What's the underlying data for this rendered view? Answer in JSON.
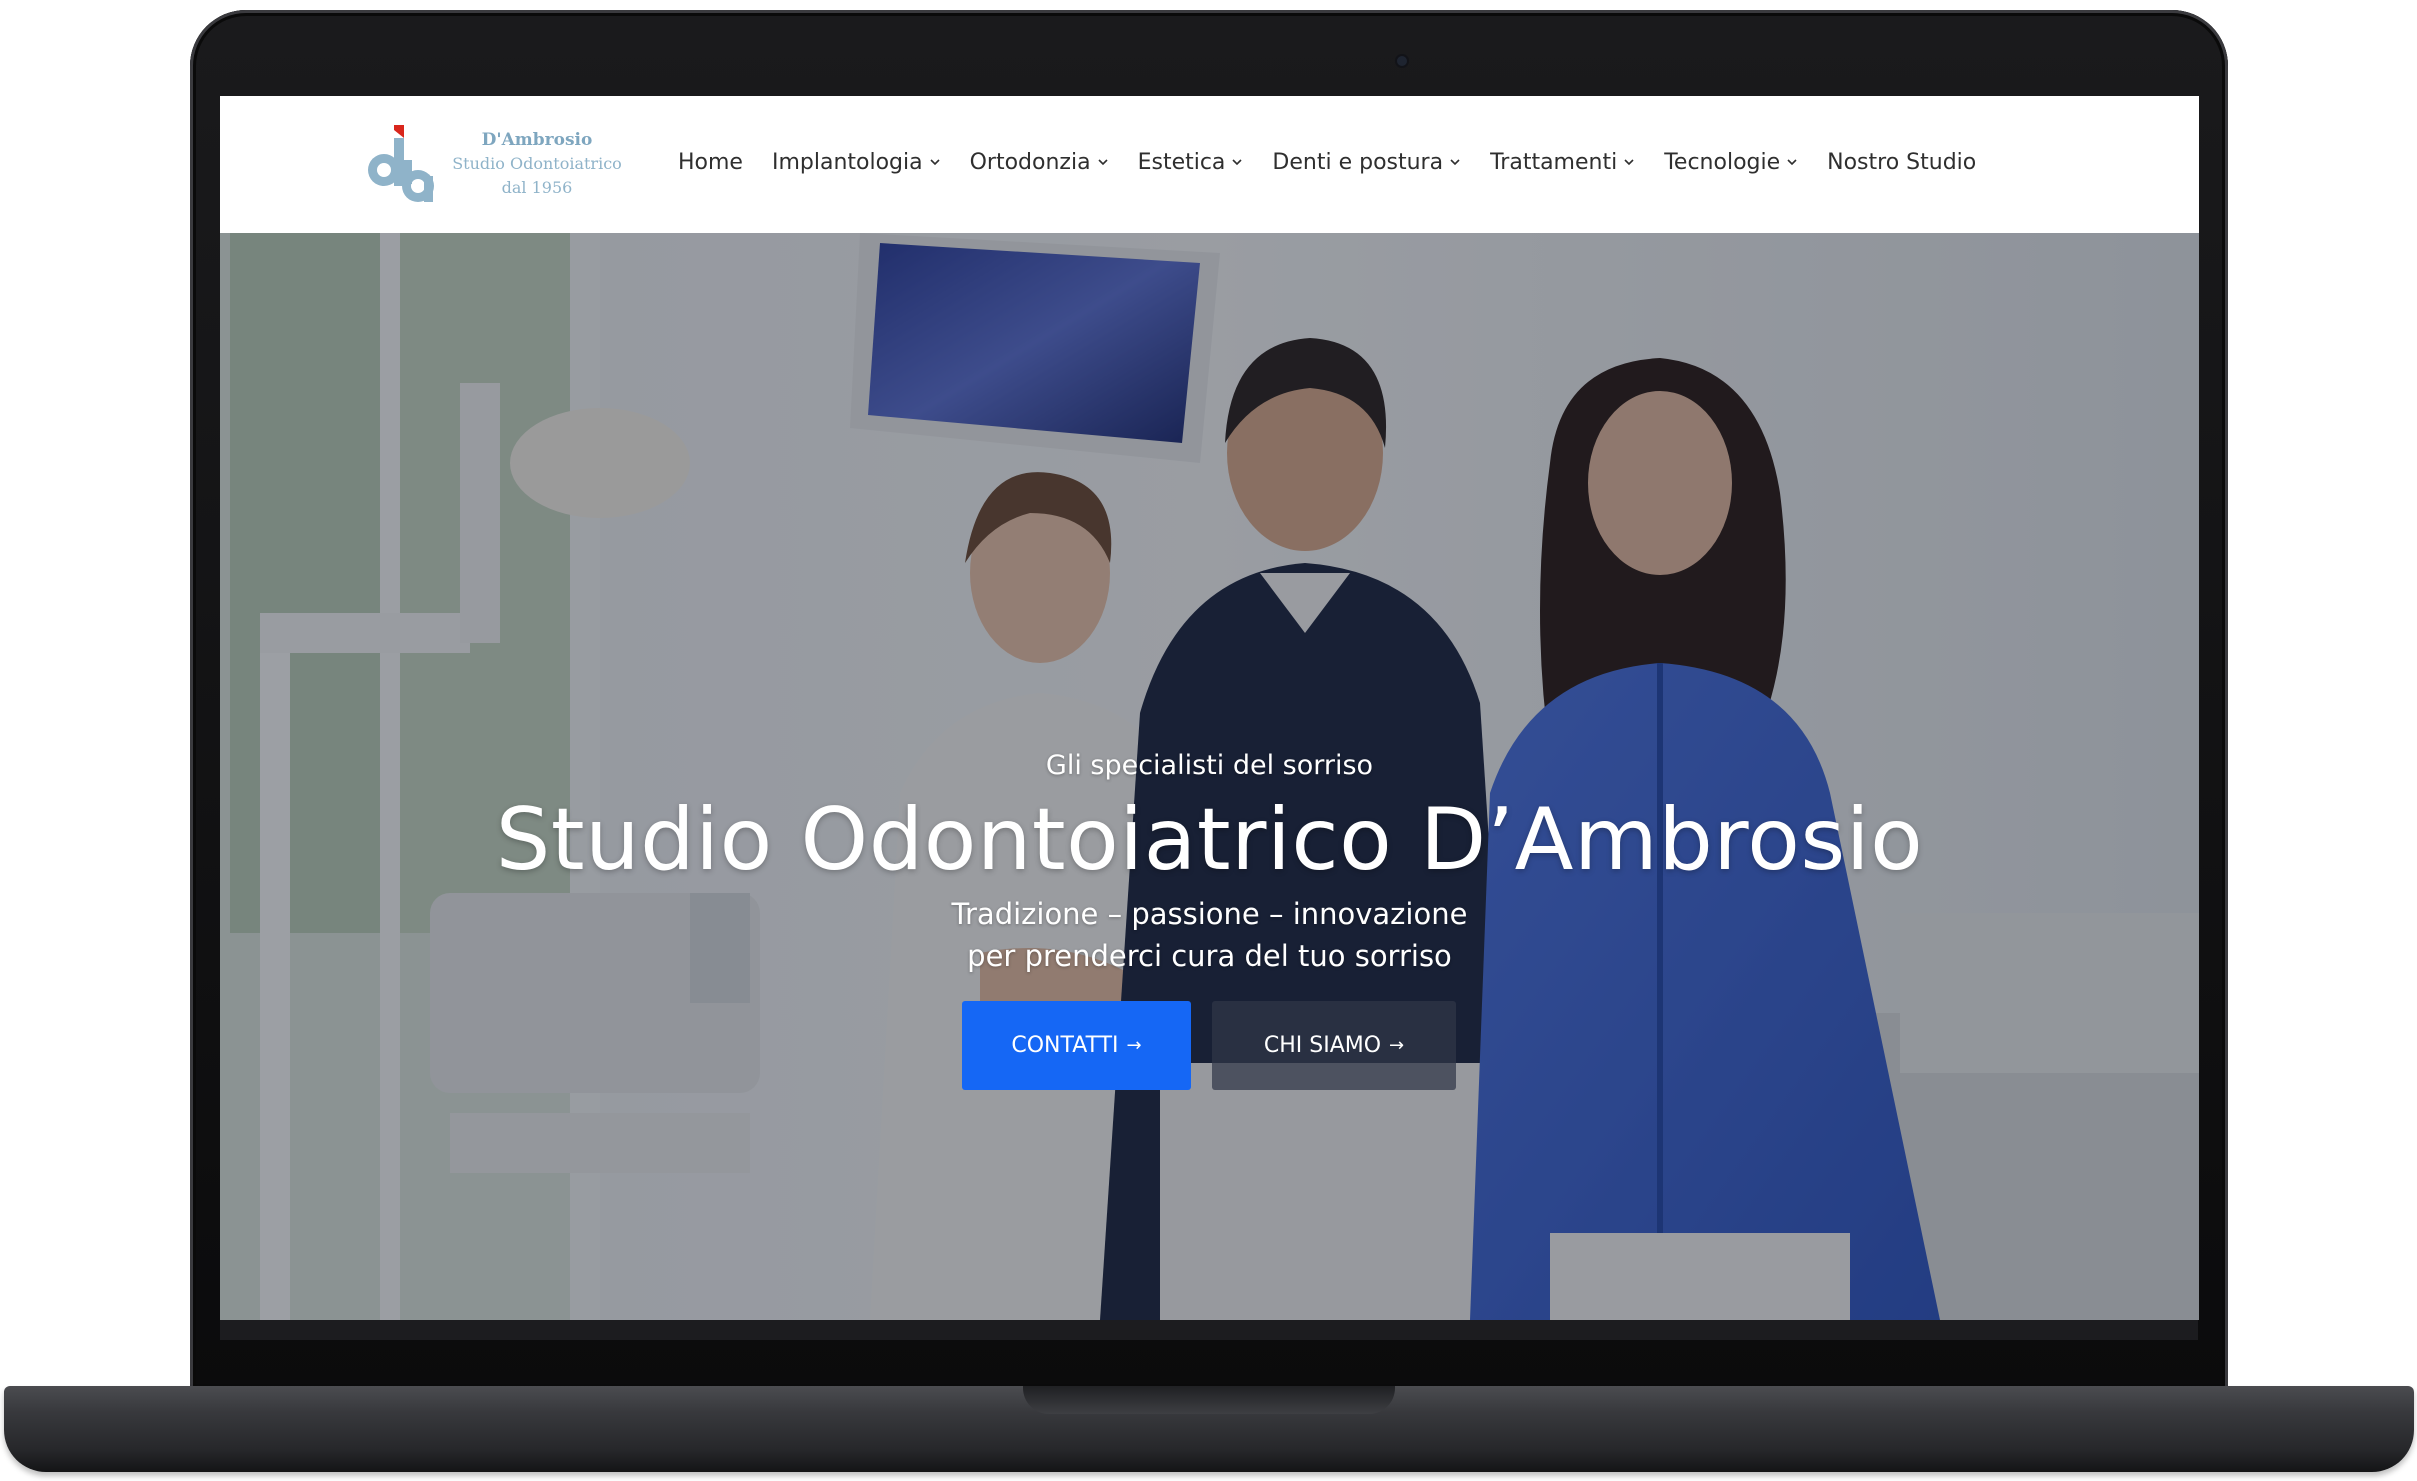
{
  "brand": {
    "name": "D'Ambrosio",
    "subtitle": "Studio Odontoiatrico",
    "since": "dal 1956",
    "colors": {
      "logo_blue": "#8fb3c9",
      "logo_red": "#d9261c"
    }
  },
  "nav": {
    "items": [
      {
        "label": "Home",
        "has_dropdown": false
      },
      {
        "label": "Implantologia",
        "has_dropdown": true
      },
      {
        "label": "Ortodonzia",
        "has_dropdown": true
      },
      {
        "label": "Estetica",
        "has_dropdown": true
      },
      {
        "label": "Denti e postura",
        "has_dropdown": true
      },
      {
        "label": "Trattamenti",
        "has_dropdown": true
      },
      {
        "label": "Tecnologie",
        "has_dropdown": true
      },
      {
        "label": "Nostro Studio",
        "has_dropdown": false
      }
    ]
  },
  "hero": {
    "kicker": "Gli specialisti del sorriso",
    "title": "Studio Odontoiatrico D’Ambrosio",
    "tagline_line1": "Tradizione – passione – innovazione",
    "tagline_line2": "per prenderci cura del tuo sorriso",
    "primary_button": "CONTATTI",
    "secondary_button": "CHI SIAMO",
    "arrow": "→",
    "colors": {
      "primary_button": "#1567f5",
      "secondary_button": "#303648"
    }
  }
}
